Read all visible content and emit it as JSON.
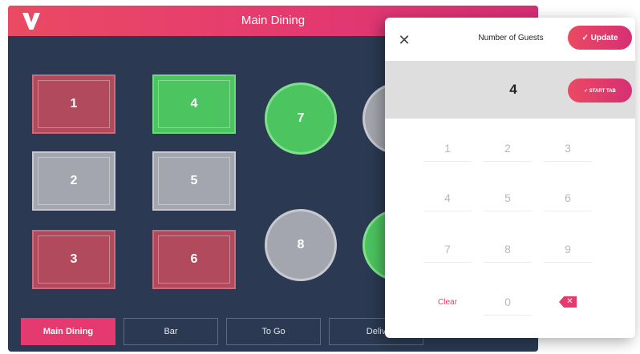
{
  "header": {
    "title": "Main Dining"
  },
  "tables": [
    {
      "label": "1",
      "status": "occupied"
    },
    {
      "label": "2",
      "status": "available"
    },
    {
      "label": "3",
      "status": "occupied"
    },
    {
      "label": "4",
      "status": "selected"
    },
    {
      "label": "5",
      "status": "available"
    },
    {
      "label": "6",
      "status": "occupied"
    },
    {
      "label": "7",
      "status": "selected"
    },
    {
      "label": "8",
      "status": "available"
    }
  ],
  "tabs": [
    {
      "label": "Main Dining",
      "active": true
    },
    {
      "label": "Bar"
    },
    {
      "label": "To Go"
    },
    {
      "label": "Deliv"
    }
  ],
  "guest_panel": {
    "title": "Number of Guests",
    "update_label": "✓ Update",
    "count": "4",
    "start_tab_label": "✓ START TAB",
    "keys": [
      "1",
      "2",
      "3",
      "4",
      "5",
      "6",
      "7",
      "8",
      "9",
      "0"
    ],
    "clear_label": "Clear"
  },
  "colors": {
    "brand": "#e43a70",
    "occupied": "#b04a5c",
    "available": "#a3a6ae",
    "selected": "#4cc45f",
    "floor": "#2b3a52"
  },
  "icons": {
    "logo": "v-logo",
    "close": "close-icon",
    "backspace": "backspace-icon"
  }
}
